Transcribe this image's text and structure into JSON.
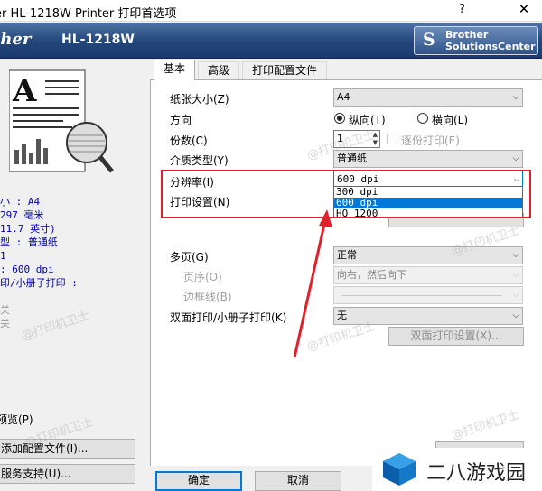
{
  "window": {
    "title": "er HL-1218W Printer 打印首选项",
    "help_label": "?",
    "close_label": "✕"
  },
  "banner": {
    "logo_text": "ther",
    "model": "HL-1218W",
    "solutions_button_line1": "Brother",
    "solutions_button_line2": "SolutionsCenter"
  },
  "preview": {
    "page_letter": "A"
  },
  "summary": {
    "lines": [
      "小 : A4",
      "297 毫米",
      "11.7 英寸)",
      "型 : 普通纸",
      " 1",
      ": 600 dpi",
      "印/小册子打印 :",
      "",
      "关",
      "关"
    ]
  },
  "left_actions": {
    "preview_label": "预览(P)",
    "add_profile_button": "添加配置文件(I)...",
    "support_button": "服务支持(U)..."
  },
  "tabs": [
    "基本",
    "高级",
    "打印配置文件"
  ],
  "form": {
    "paper_size": {
      "label": "纸张大小(Z)",
      "value": "A4"
    },
    "orientation": {
      "label": "方向",
      "options": [
        "纵向(T)",
        "横向(L)"
      ],
      "selected": 0
    },
    "copies": {
      "label": "份数(C)",
      "value": "1",
      "collate_label": "逐份打印(E)"
    },
    "media_type": {
      "label": "介质类型(Y)",
      "value": "普通纸"
    },
    "resolution": {
      "label": "分辨率(I)",
      "value": "600 dpi",
      "options": [
        "300 dpi",
        "600 dpi",
        "HQ 1200"
      ],
      "highlighted": 1
    },
    "print_settings": {
      "label": "打印设置(N)"
    },
    "multi_page": {
      "label": "多页(G)",
      "value": "正常"
    },
    "page_order": {
      "label": "页序(O)",
      "value": "向右，然后向下"
    },
    "border_line": {
      "label": "边框线(B)"
    },
    "duplex": {
      "label": "双面打印/小册子打印(K)",
      "value": "无",
      "settings_button": "双面打印设置(X)..."
    }
  },
  "footer": {
    "ok_button": "确定",
    "cancel_button": "取消"
  },
  "watermark_text": "@打印机卫士",
  "corner_logo": {
    "text": "二八游戏园"
  },
  "colors": {
    "banner": "#23467a",
    "selection": "#0078d7",
    "annotation": "#e0212b",
    "summary_text": "#0000b4"
  }
}
